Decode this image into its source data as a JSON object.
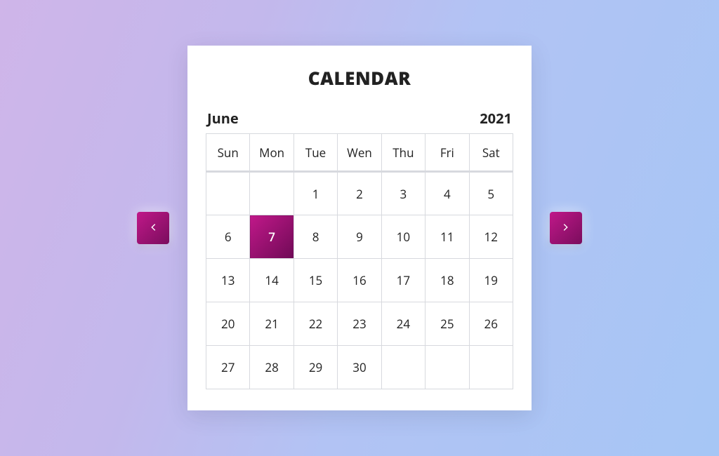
{
  "title": "CALENDAR",
  "month": "June",
  "year": "2021",
  "weekdays": [
    "Sun",
    "Mon",
    "Tue",
    "Wen",
    "Thu",
    "Fri",
    "Sat"
  ],
  "selected_day": 7,
  "grid": [
    [
      "",
      "",
      "1",
      "2",
      "3",
      "4",
      "5"
    ],
    [
      "6",
      "7",
      "8",
      "9",
      "10",
      "11",
      "12"
    ],
    [
      "13",
      "14",
      "15",
      "16",
      "17",
      "18",
      "19"
    ],
    [
      "20",
      "21",
      "22",
      "23",
      "24",
      "25",
      "26"
    ],
    [
      "27",
      "28",
      "29",
      "30",
      "",
      "",
      ""
    ]
  ],
  "colors": {
    "accent_start": "#c01889",
    "accent_end": "#7a0d5d"
  }
}
